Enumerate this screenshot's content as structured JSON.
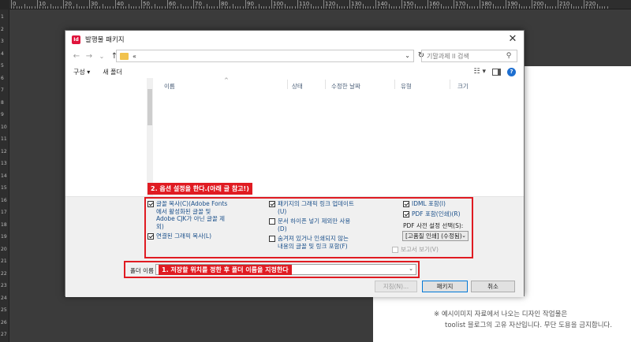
{
  "ruler": {
    "top_labels": [
      "0",
      "10",
      "20",
      "30",
      "40",
      "50",
      "60",
      "70",
      "80",
      "90",
      "100",
      "110",
      "120",
      "130",
      "140",
      "150",
      "160",
      "170",
      "180",
      "190",
      "200",
      "210",
      "220"
    ],
    "left_labels": [
      "1",
      "2",
      "3",
      "4",
      "5",
      "6",
      "7",
      "8",
      "9",
      "10",
      "11",
      "12",
      "13",
      "14",
      "15",
      "16",
      "17",
      "18",
      "19",
      "20",
      "21",
      "22",
      "23",
      "24",
      "25",
      "26",
      "27"
    ]
  },
  "dialog": {
    "title": "발행물 패키지",
    "close": "✕",
    "app_icon": "Id"
  },
  "nav": {
    "back": "←",
    "forward": "→",
    "dropdown": "⌄",
    "up": "↑",
    "address_text": "«",
    "address_dropdown": "⌄",
    "refresh": "↻",
    "search_placeholder": "기말과제 ll 검색",
    "search_icon": "⚲"
  },
  "toolbar": {
    "organize": "구성 ▾",
    "new_folder": "새 폴더",
    "view_icon": "☷ ▾",
    "help": "?"
  },
  "columns": {
    "name": "이름",
    "status": "상태",
    "modified": "수정한 날짜",
    "type": "유형",
    "size": "크기",
    "sort_indicator": "^"
  },
  "annotations": {
    "options": "2. 옵션 설정을 한다.(아래 글 참고!)",
    "folder": "1. 저장할 위치를 정한 후 폴더 이름을 지정한다"
  },
  "options": {
    "copy_fonts": {
      "label": "글꼴 복사(C)(Adobe Fonts 에서 활성화된 글꼴 및 Adobe CJK가 아닌 글꼴 제외)",
      "checked": true
    },
    "copy_linked": {
      "label": "연결된 그래픽 복사(L)",
      "checked": true
    },
    "update_links": {
      "label": "패키지의 그래픽 링크 업데이트(U)",
      "checked": true
    },
    "doc_hyphen": {
      "label": "문서 하이픈 넣기 제외만 사용(D)",
      "checked": false
    },
    "hidden_content": {
      "label": "숨겨져 있거나 인쇄되지 않는 내용의 글꼴 및 링크 포함(F)",
      "checked": false
    },
    "idml": {
      "label": "IDML 포함(I)",
      "checked": true
    },
    "pdf_print": {
      "label": "PDF 포함(인쇄)(R)",
      "checked": true
    },
    "pdf_preset_label": "PDF 사전 설정 선택(S):",
    "pdf_preset_value": "[고품질 인쇄] (수정됨)",
    "view_report": {
      "label": "보고서 보기(V)",
      "checked": false
    }
  },
  "folder": {
    "label": "폴더 이름",
    "value": ""
  },
  "buttons": {
    "instructions": "지침(N)...",
    "package": "패키지",
    "cancel": "취소"
  },
  "watermark": {
    "line1": "※  예시이미지 자료에서 나오는 디자인 작업물은",
    "line2": "toolist 블로그의 고유 자산입니다. 무단 도용을 금지합니다."
  }
}
